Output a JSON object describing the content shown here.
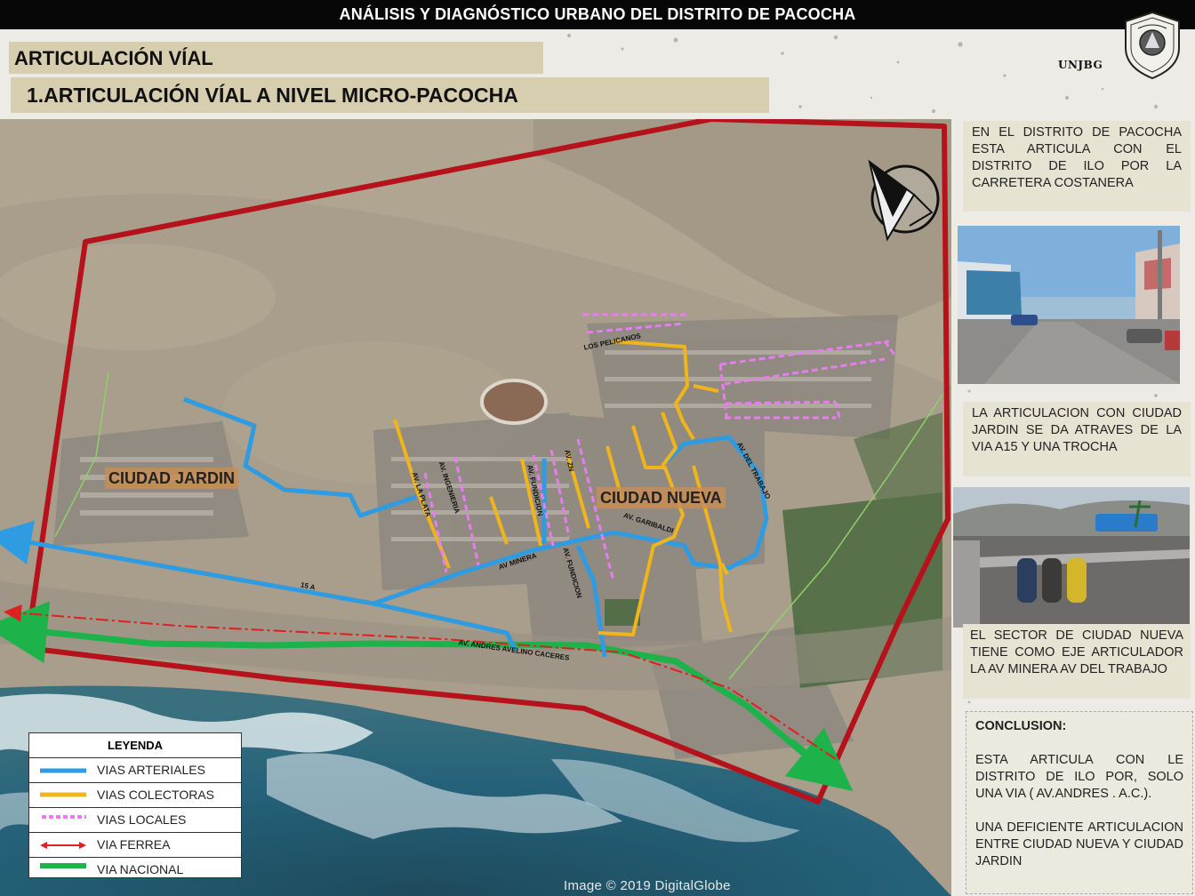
{
  "header": {
    "title": "ANÁLISIS Y DIAGNÓSTICO URBANO DEL DISTRITO DE PACOCHA",
    "section": "ARTICULACIÓN VÍAL",
    "subsection": "1.ARTICULACIÓN VÍAL A NIVEL MICRO-PACOCHA",
    "institution": "UNJBG"
  },
  "map": {
    "sector_labels": {
      "ciudad_jardin": "CIUDAD JARDIN",
      "ciudad_nueva": "CIUDAD NUEVA"
    },
    "road_labels": {
      "los_pelicanos": "LOS PELICANOS",
      "av_ingenieria": "AV. INGENIERIA",
      "av_la_plata": "AV. LA PLATA",
      "av_fundicion_1": "AV. FUNDICION",
      "av_zn": "AV. ZN",
      "av_del_trabajo": "AV. DEL TRABAJO",
      "av_garibaldi": "AV. GARIBALDI",
      "av_minera": "AV MINERA",
      "av_fundicion_2": "AV. FUNDICION",
      "via_15a": "15 A",
      "av_andres": "AV. ANDRES AVELINO CACERES"
    },
    "image_credit": "Image © 2019 DigitalGlobe",
    "colors": {
      "boundary": "#b5121b",
      "arterial": "#2f9be0",
      "collector": "#f0b51a",
      "local": "#e77df0",
      "rail": "#e0201f",
      "national": "#1db34a"
    }
  },
  "legend": {
    "title": "LEYENDA",
    "items": [
      {
        "label": "VIAS ARTERIALES"
      },
      {
        "label": "VIAS COLECTORAS"
      },
      {
        "label": "VIAS LOCALES"
      },
      {
        "label": "VIA FERREA"
      },
      {
        "label": "VIA  NACIONAL"
      }
    ]
  },
  "notes": {
    "n1": "EN EL DISTRITO DE PACOCHA ESTA ARTICULA CON EL DISTRITO DE ILO POR LA CARRETERA COSTANERA",
    "n2": "LA ARTICULACION CON CIUDAD JARDIN SE DA ATRAVES DE LA VIA A15 Y UNA TROCHA",
    "n3": "EL SECTOR DE CIUDAD NUEVA TIENE COMO EJE ARTICULADOR LA AV MINERA AV DEL TRABAJO",
    "conclusion_title": "CONCLUSION:",
    "conclusion_p1": "ESTA ARTICULA CON LE DISTRITO DE ILO POR, SOLO UNA VIA ( AV.ANDRES . A.C.).",
    "conclusion_p2": "UNA DEFICIENTE ARTICULACION ENTRE CIUDAD NUEVA Y CIUDAD JARDIN"
  }
}
